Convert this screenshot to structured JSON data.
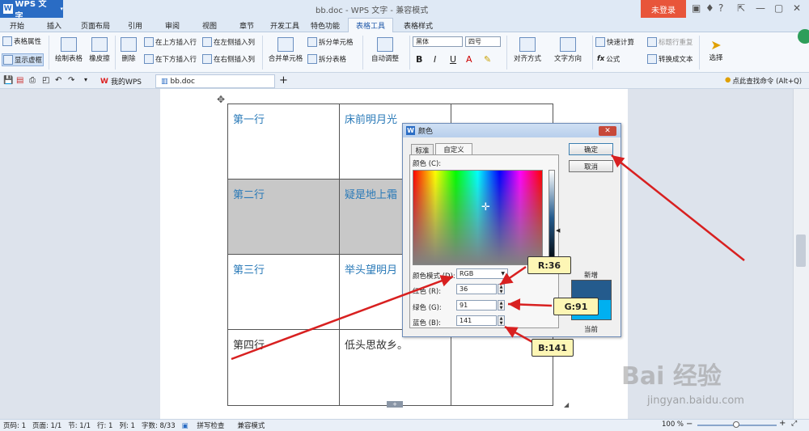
{
  "titlebar": {
    "app_name": "WPS 文字",
    "app_letter": "W",
    "title": "bb.doc - WPS 文字 - 兼容模式",
    "login": "未登录",
    "help": "?"
  },
  "menu_tabs": [
    "开始",
    "插入",
    "页面布局",
    "引用",
    "审阅",
    "视图",
    "章节",
    "开发工具",
    "特色功能",
    "表格工具",
    "表格样式"
  ],
  "ribbon": {
    "table_props": "表格属性",
    "show_gridlines": "显示虚框",
    "draw_table": "绘制表格",
    "eraser": "橡皮擦",
    "delete": "删除",
    "insert_above": "在上方插入行",
    "insert_below": "在下方插入行",
    "insert_left": "在左侧插入列",
    "insert_right": "在右侧插入列",
    "merge_cells": "合并单元格",
    "split_cell": "拆分单元格",
    "split_table": "拆分表格",
    "autofit": "自动调整",
    "font_name": "黑体",
    "font_size": "四号",
    "bold": "B",
    "italic": "I",
    "underline": "U",
    "align": "对齐方式",
    "text_direction": "文字方向",
    "quick_calc": "快速计算",
    "repeat_header": "标题行重复",
    "formula": "公式",
    "convert_text": "转换成文本",
    "select": "选择"
  },
  "quickbar": {
    "tab1": "我的WPS",
    "tab2": "bb.doc",
    "add": "+",
    "find_cmd": "点此查找命令 (Alt+Q)"
  },
  "table": {
    "rows": [
      [
        "第一行",
        "床前明月光",
        ""
      ],
      [
        "第二行",
        "疑是地上霜",
        ""
      ],
      [
        "第三行",
        "举头望明月",
        ""
      ],
      [
        "第四行",
        "低头思故乡。",
        ""
      ]
    ]
  },
  "dialog": {
    "title": "颜色",
    "close": "✕",
    "tab_standard": "标准",
    "tab_custom": "自定义",
    "colors_label": "颜色 (C):",
    "mode_label": "颜色模式 (D):",
    "mode_value": "RGB",
    "red_label": "红色 (R):",
    "green_label": "绿色 (G):",
    "blue_label": "蓝色 (B):",
    "red": "36",
    "green": "91",
    "blue": "141",
    "ok": "确定",
    "cancel": "取消",
    "new_label": "新增",
    "current_label": "当前",
    "new_color": "#245b8d",
    "current_color": "#00b0f0"
  },
  "callouts": {
    "r": "R:36",
    "g": "G:91",
    "b": "B:141"
  },
  "statusbar": {
    "page": "页码: 1",
    "pages": "页面: 1/1",
    "section": "节: 1/1",
    "row": "行: 1",
    "col": "列: 1",
    "words": "字数: 8/33",
    "spell": "拼写检查",
    "compat": "兼容模式",
    "zoom": "100 %"
  },
  "watermark": {
    "text": "Bai 经验",
    "url": "jingyan.baidu.com"
  },
  "colors": {
    "arrow": "#d82020",
    "accent": "#2a6cc4",
    "login": "#e8553a"
  }
}
